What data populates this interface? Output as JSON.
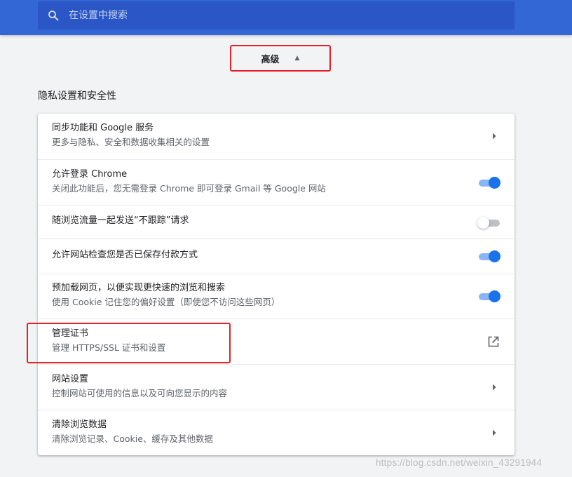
{
  "search": {
    "placeholder": "在设置中搜索"
  },
  "advanced": {
    "label": "高级",
    "expanded": true
  },
  "section": {
    "title": "隐私设置和安全性"
  },
  "rows": [
    {
      "title": "同步功能和 Google 服务",
      "subtitle": "更多与隐私、安全和数据收集相关的设置",
      "control": "chevron"
    },
    {
      "title": "允许登录 Chrome",
      "subtitle": "关闭此功能后，您无需登录 Chrome 即可登录 Gmail 等 Google 网站",
      "control": "toggle",
      "on": true
    },
    {
      "title": "随浏览流量一起发送“不跟踪”请求",
      "subtitle": "",
      "control": "toggle",
      "on": false
    },
    {
      "title": "允许网站检查您是否已保存付款方式",
      "subtitle": "",
      "control": "toggle",
      "on": true
    },
    {
      "title": "预加载网页，以便实现更快速的浏览和搜索",
      "subtitle": "使用 Cookie 记住您的偏好设置（即使您不访问这些网页）",
      "control": "toggle",
      "on": true
    },
    {
      "title": "管理证书",
      "subtitle": "管理 HTTPS/SSL 证书和设置",
      "control": "external-link"
    },
    {
      "title": "网站设置",
      "subtitle": "控制网站可使用的信息以及可向您显示的内容",
      "control": "chevron"
    },
    {
      "title": "清除浏览数据",
      "subtitle": "清除浏览记录、Cookie、缓存及其他数据",
      "control": "chevron"
    }
  ],
  "watermark": "https://blog.csdn.net/weixin_43291944",
  "colors": {
    "header": "#3367d6",
    "toggle_on": "#1a73e8",
    "annotation": "#e5202a"
  }
}
